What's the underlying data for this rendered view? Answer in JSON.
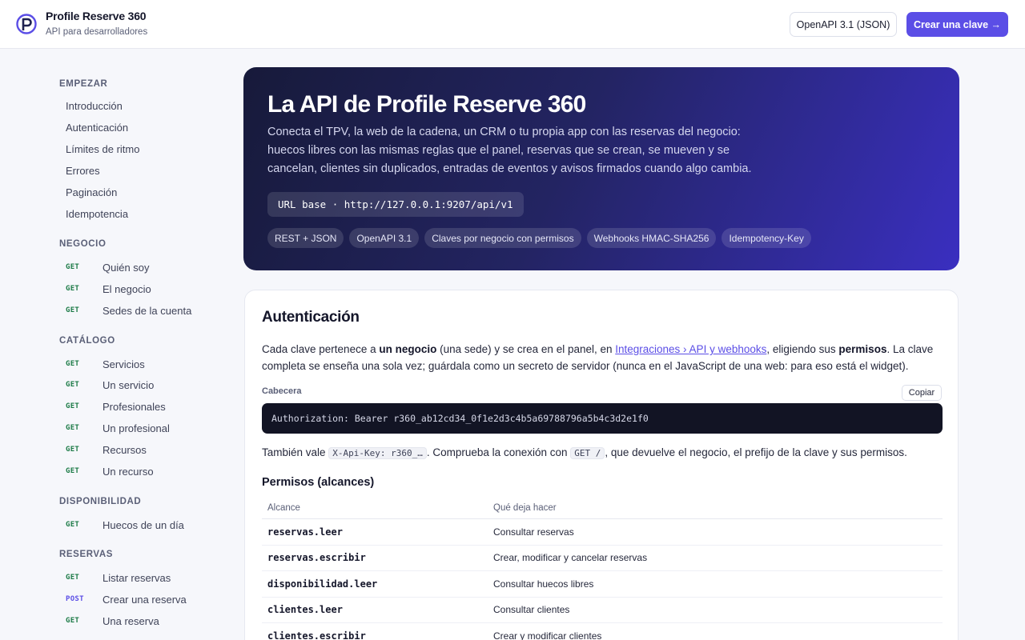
{
  "header": {
    "brand_title": "Profile Reserve 360",
    "brand_subtitle": "API para desarrolladores",
    "openapi_button": "OpenAPI 3.1 (JSON)",
    "create_key_button": "Crear una clave →",
    "accent_color": "#5b4ee6"
  },
  "sidebar": {
    "sections": [
      {
        "title": "EMPEZAR",
        "links": [
          "Introducción",
          "Autenticación",
          "Límites de ritmo",
          "Errores",
          "Paginación",
          "Idempotencia"
        ]
      },
      {
        "title": "NEGOCIO",
        "endpoints": [
          {
            "method": "GET",
            "label": "Quién soy"
          },
          {
            "method": "GET",
            "label": "El negocio"
          },
          {
            "method": "GET",
            "label": "Sedes de la cuenta"
          }
        ]
      },
      {
        "title": "CATÁLOGO",
        "endpoints": [
          {
            "method": "GET",
            "label": "Servicios"
          },
          {
            "method": "GET",
            "label": "Un servicio"
          },
          {
            "method": "GET",
            "label": "Profesionales"
          },
          {
            "method": "GET",
            "label": "Un profesional"
          },
          {
            "method": "GET",
            "label": "Recursos"
          },
          {
            "method": "GET",
            "label": "Un recurso"
          }
        ]
      },
      {
        "title": "DISPONIBILIDAD",
        "endpoints": [
          {
            "method": "GET",
            "label": "Huecos de un día"
          }
        ]
      },
      {
        "title": "RESERVAS",
        "endpoints": [
          {
            "method": "GET",
            "label": "Listar reservas"
          },
          {
            "method": "POST",
            "label": "Crear una reserva"
          },
          {
            "method": "GET",
            "label": "Una reserva"
          }
        ]
      }
    ]
  },
  "hero": {
    "title": "La API de Profile Reserve 360",
    "description": "Conecta el TPV, la web de la cadena, un CRM o tu propia app con las reservas del negocio: huecos libres con las mismas reglas que el panel, reservas que se crean, se mueven y se cancelan, clientes sin duplicados, entradas de eventos y avisos firmados cuando algo cambia.",
    "base_url": "URL base · http://127.0.0.1:9207/api/v1",
    "tags": [
      "REST + JSON",
      "OpenAPI 3.1",
      "Claves por negocio con permisos",
      "Webhooks HMAC-SHA256",
      "Idempotency-Key"
    ]
  },
  "auth": {
    "title": "Autenticación",
    "p1_a": "Cada clave pertenece a ",
    "p1_b": "un negocio",
    "p1_c": " (una sede) y se crea en el panel, en ",
    "p1_link": "Integraciones › API y webhooks",
    "p1_d": ", eligiendo sus ",
    "p1_e": "permisos",
    "p1_f": ". La clave completa se enseña una sola vez; guárdala como un secreto de servidor (nunca en el JavaScript de una web: para eso está el widget).",
    "header_label": "Cabecera",
    "copy_button": "Copiar",
    "code": "Authorization: Bearer r360_ab12cd34_0f1e2d3c4b5a69788796a5b4c3d2e1f0",
    "p2_a": "También vale ",
    "p2_code1": "X-Api-Key: r360_…",
    "p2_b": ". Comprueba la conexión con ",
    "p2_code2": "GET /",
    "p2_c": ", que devuelve el negocio, el prefijo de la clave y sus permisos.",
    "scopes_title": "Permisos (alcances)",
    "table_headers": [
      "Alcance",
      "Qué deja hacer"
    ],
    "scopes": [
      {
        "scope": "reservas.leer",
        "desc": "Consultar reservas"
      },
      {
        "scope": "reservas.escribir",
        "desc": "Crear, modificar y cancelar reservas"
      },
      {
        "scope": "disponibilidad.leer",
        "desc": "Consultar huecos libres"
      },
      {
        "scope": "clientes.leer",
        "desc": "Consultar clientes"
      },
      {
        "scope": "clientes.escribir",
        "desc": "Crear y modificar clientes"
      }
    ]
  }
}
